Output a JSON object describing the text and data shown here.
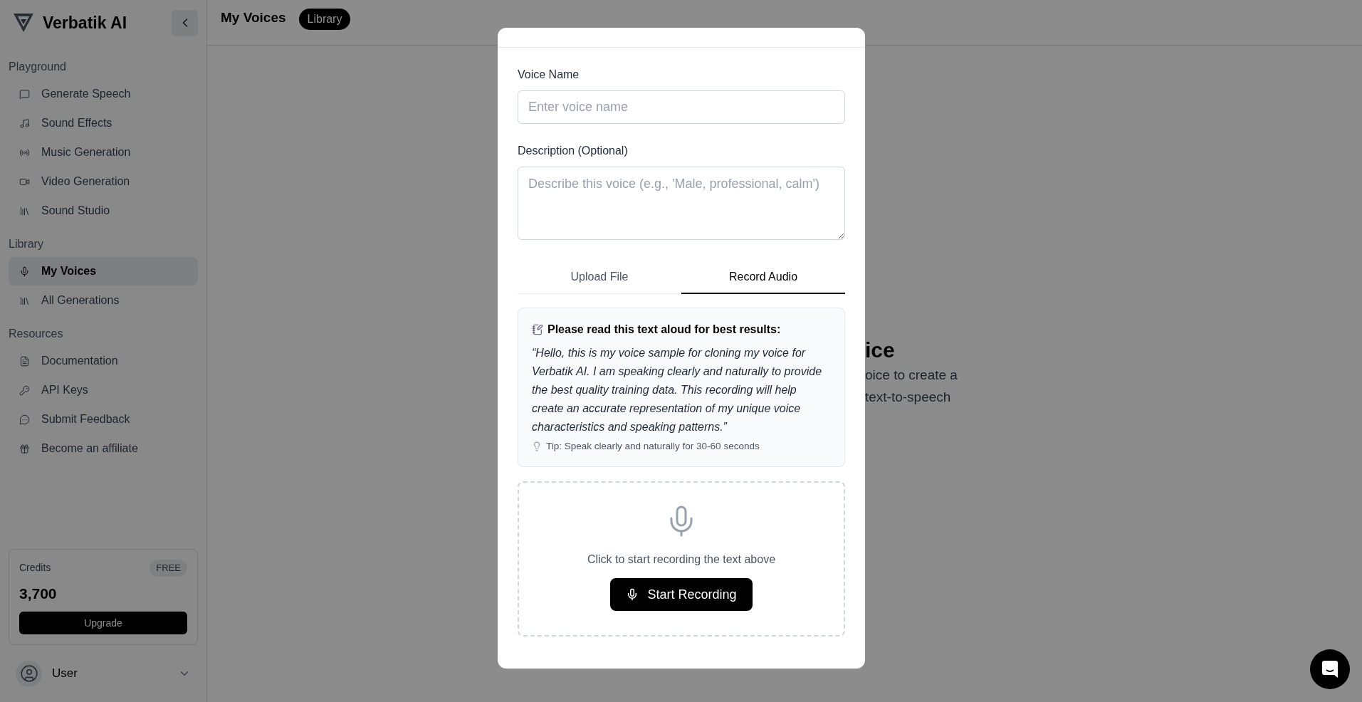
{
  "sidebar": {
    "brand": "Verbatik AI",
    "sections": [
      {
        "title": "Playground",
        "items": [
          {
            "label": "Generate Speech",
            "selected": false
          },
          {
            "label": "Sound Effects",
            "selected": false
          },
          {
            "label": "Music Generation",
            "selected": false
          },
          {
            "label": "Video Generation",
            "selected": false
          },
          {
            "label": "Sound Studio",
            "selected": false
          }
        ]
      },
      {
        "title": "Library",
        "items": [
          {
            "label": "My Voices",
            "selected": true
          },
          {
            "label": "All Generations",
            "selected": false
          }
        ]
      },
      {
        "title": "Resources",
        "items": [
          {
            "label": "Documentation",
            "selected": false
          },
          {
            "label": "API Keys",
            "selected": false
          },
          {
            "label": "Submit Feedback",
            "selected": false
          },
          {
            "label": "Become an affiliate",
            "selected": false
          }
        ]
      }
    ],
    "credits": {
      "label": "Credits",
      "plan": "FREE",
      "amount": "3,700",
      "button": "Upgrade"
    },
    "user": {
      "name": "User"
    }
  },
  "header": {
    "title": "My Voices",
    "badge": "Library"
  },
  "background": {
    "heading": "ice",
    "lines": [
      "oice to create a",
      "text-to-speech"
    ]
  },
  "modal": {
    "fields": [
      {
        "kind": "input",
        "label": "Voice Name",
        "placeholder": "Enter voice name"
      },
      {
        "kind": "textarea",
        "label": "Description (Optional)",
        "placeholder": "Describe this voice (e.g., 'Male, professional, calm')"
      }
    ],
    "tabs": [
      {
        "label": "Upload File",
        "selected": false
      },
      {
        "label": "Record Audio",
        "selected": true
      }
    ],
    "prompt": {
      "heading": "Please read this text aloud for best results:",
      "quote": "“Hello, this is my voice sample for cloning my voice for Verbatik AI. I am speaking clearly and naturally to provide the best quality training data. This recording will help create an accurate representation of my unique voice characteristics and speaking patterns.”",
      "tip": "Tip: Speak clearly and naturally for 30-60 seconds"
    },
    "recorder": {
      "hint": "Click to start recording the text above",
      "button": "Start Recording"
    }
  }
}
